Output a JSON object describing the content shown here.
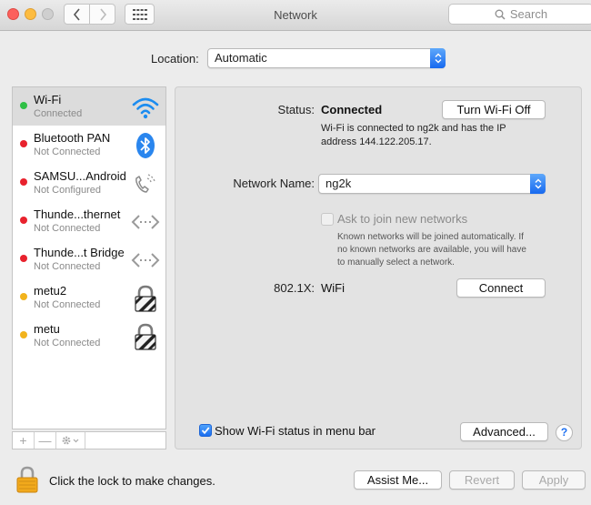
{
  "window": {
    "title": "Network",
    "search_placeholder": "Search"
  },
  "location": {
    "label": "Location:",
    "value": "Automatic"
  },
  "services": [
    {
      "name": "Wi-Fi",
      "status": "Connected",
      "dot_color": "#2fc046",
      "icon": "wifi-icon",
      "selected": true
    },
    {
      "name": "Bluetooth PAN",
      "status": "Not Connected",
      "dot_color": "#e8222d",
      "icon": "bluetooth-icon"
    },
    {
      "name": "SAMSU...Android",
      "status": "Not Configured",
      "dot_color": "#e8222d",
      "icon": "phone-icon"
    },
    {
      "name": "Thunde...thernet",
      "status": "Not Connected",
      "dot_color": "#e8222d",
      "icon": "ethernet-icon"
    },
    {
      "name": "Thunde...t Bridge",
      "status": "Not Connected",
      "dot_color": "#e8222d",
      "icon": "ethernet-icon"
    },
    {
      "name": "metu2",
      "status": "Not Connected",
      "dot_color": "#f2b31c",
      "icon": "vpn-lock-icon"
    },
    {
      "name": "metu",
      "status": "Not Connected",
      "dot_color": "#f2b31c",
      "icon": "vpn-lock-icon"
    }
  ],
  "sidebar_buttons": {
    "add": "+",
    "remove": "—"
  },
  "detail": {
    "status_label": "Status:",
    "status_value": "Connected",
    "turn_off_button": "Turn Wi-Fi Off",
    "status_description_line1": "Wi-Fi is connected to ng2k and has the IP",
    "status_description_line2": "address 144.122.205.17.",
    "network_name_label": "Network Name:",
    "network_name_value": "ng2k",
    "ask_join_label": "Ask to join new networks",
    "ask_join_checked": false,
    "ask_join_hint_line1": "Known networks will be joined automatically. If",
    "ask_join_hint_line2": "no known networks are available, you will have",
    "ask_join_hint_line3": "to manually select a network.",
    "dot1x_label": "802.1X:",
    "dot1x_value": "WiFi",
    "connect_button": "Connect",
    "show_status_label": "Show Wi-Fi status in menu bar",
    "show_status_checked": true,
    "advanced_button": "Advanced...",
    "help_button": "?"
  },
  "footer": {
    "lock_text": "Click the lock to make changes.",
    "assist_button": "Assist Me...",
    "revert_button": "Revert",
    "apply_button": "Apply"
  }
}
